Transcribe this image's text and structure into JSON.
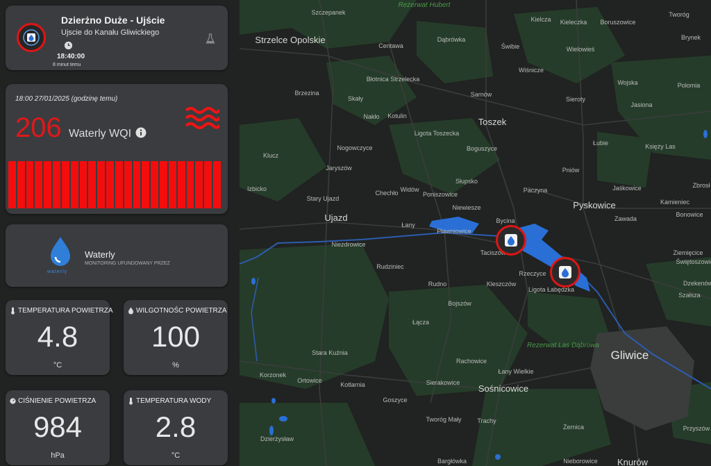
{
  "station": {
    "title": "Dzierżno Duże - Ujście",
    "subtitle": "Ujscie do Kanału Gliwickiego",
    "time": "18:40:00",
    "ago": "8 minut temu",
    "icons": [
      "station-logo-icon",
      "clock-icon",
      "flask-icon"
    ]
  },
  "wqi": {
    "timestamp": "18:00 27/01/2025 (godzinę temu)",
    "value": "206",
    "unit": "Waterly WQI",
    "status_color": "#e01818",
    "bar_color": "#f40d0d",
    "icons": [
      "info-icon",
      "waves-icon"
    ]
  },
  "sponsor": {
    "name": "Waterly",
    "tagline": "MONITORING UFUNDOWANY PRZEZ",
    "logo_caption": "waterly",
    "brand_color": "#3a8de0"
  },
  "sensors": [
    {
      "label": "TEMPERATURA POWIETRZA",
      "value": "4.8",
      "unit": "°C",
      "icon": "thermometer-icon"
    },
    {
      "label": "WILGOTNOŚC POWIETRZA",
      "value": "100",
      "unit": "%",
      "icon": "droplet-icon"
    },
    {
      "label": "CIŚNIENIE POWIETRZA",
      "value": "984",
      "unit": "hPa",
      "icon": "gauge-icon"
    },
    {
      "label": "TEMPERATURA WODY",
      "value": "2.8",
      "unit": "°C",
      "icon": "thermometer-icon"
    }
  ],
  "map": {
    "places": {
      "p1": "Szczepanek",
      "p2": "Rezerwat Hubert",
      "p3": "Strzelce Opolskie",
      "p4": "Centawa",
      "p5": "Dąbrówka",
      "p6": "Świbie",
      "p7": "Kielcza",
      "p8": "Kieleczka",
      "p9": "Wielowieś",
      "p10": "Tworóg",
      "p11": "Brynek",
      "p12": "Boruszowice",
      "p13": "Błotnica Strzelecka",
      "p14": "Wiśnicze",
      "p15": "Brzezina",
      "p16": "Sarnów",
      "p17": "Sieroty",
      "p18": "Wojska",
      "p19": "Polomia",
      "p20": "Jasiona",
      "p21": "Skały",
      "p22": "Nakło",
      "p23": "Kotulin",
      "p24": "Toszek",
      "p25": "Ligota Toszecka",
      "p26": "Łubie",
      "p27": "Księży Las",
      "p28": "Klucz",
      "p29": "Nogowczyce",
      "p30": "Boguszyce",
      "p31": "Jaryszów",
      "p32": "Pniów",
      "p33": "Słupsko",
      "p34": "Jaśkowice",
      "p35": "Zbrosł",
      "p36": "Izbicko",
      "p37": "Chechło",
      "p38": "Widów",
      "p39": "Poniszowice",
      "p40": "Paczyna",
      "p41": "Stary Ujazd",
      "p42": "Niewiesze",
      "p43": "Pyskowice",
      "p44": "Kamieniec",
      "p45": "Bonowice",
      "p46": "Ujazd",
      "p47": "Łany",
      "p48": "Pławniowice",
      "p49": "Bycina",
      "p50": "Zawada",
      "p51": "Niezdrowice",
      "p52": "Taciszów",
      "p53": "Ziemięcice",
      "p54": "Świętoszowice",
      "p55": "Rudziniec",
      "p56": "Rzeczyce",
      "p57": "Rudno",
      "p58": "Kleszczów",
      "p59": "Ligota Łabędzka",
      "p60": "Dzekenów",
      "p61": "Bojszów",
      "p62": "Szałsza",
      "p63": "Łącza",
      "p64": "Rezerwat Las Dąbrowa",
      "p65": "Stara Kuźnia",
      "p66": "Gliwice",
      "p67": "Rachowice",
      "p68": "Łany Wielkie",
      "p69": "Korzonek",
      "p70": "Ortowice",
      "p71": "Kotlarnia",
      "p72": "Sierakowice",
      "p73": "Sośnicowice",
      "p74": "Goszyce",
      "p75": "Tworóg Mały",
      "p76": "Trachy",
      "p77": "Żernica",
      "p78": "Przyszów",
      "p79": "Dzierżysław",
      "p80": "Bargłówka",
      "p81": "Nieborowice",
      "p82": "Knurów"
    }
  }
}
